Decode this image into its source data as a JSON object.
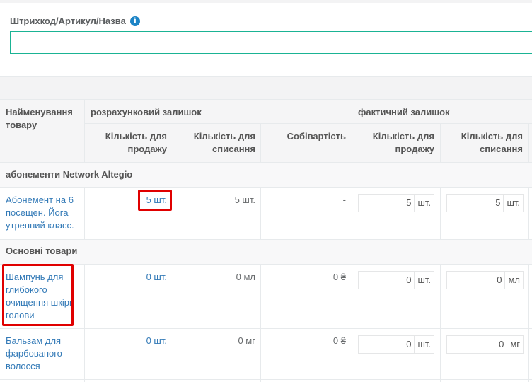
{
  "search": {
    "label": "Штрихкод/Артикул/Назва",
    "info_icon": "info-icon",
    "value": ""
  },
  "columns": {
    "name": "Найменування товару",
    "estimated_group": "розрахунковий залишок",
    "actual_group": "фактичний залишок",
    "sale_qty": "Кількість для продажу",
    "writeoff_qty": "Кількість для списання",
    "cost": "Собівартість"
  },
  "groups": [
    {
      "title": "абонементи Network Altegio"
    },
    {
      "title": "Основні товари"
    }
  ],
  "rows": [
    {
      "name": "Абонемент на 6 посещен. Йога утренний класс.",
      "sale": "5 шт.",
      "writeoff": "5 шт.",
      "cost": "-",
      "actual_sale": "5",
      "actual_sale_unit": "шт.",
      "actual_writeoff": "5",
      "actual_writeoff_unit": "шт."
    },
    {
      "name": "Шампунь для глибокого очищення шкіри голови",
      "sale": "0 шт.",
      "writeoff": "0 мл",
      "cost": "0 ₴",
      "actual_sale": "0",
      "actual_sale_unit": "шт.",
      "actual_writeoff": "0",
      "actual_writeoff_unit": "мл"
    },
    {
      "name": "Бальзам для фарбованого волосся",
      "sale": "0 шт.",
      "writeoff": "0 мг",
      "cost": "0 ₴",
      "actual_sale": "0",
      "actual_sale_unit": "шт.",
      "actual_writeoff": "0",
      "actual_writeoff_unit": "мг"
    }
  ],
  "colors": {
    "link": "#337ab7",
    "accent": "#1ab394",
    "highlight": "#e00000"
  }
}
